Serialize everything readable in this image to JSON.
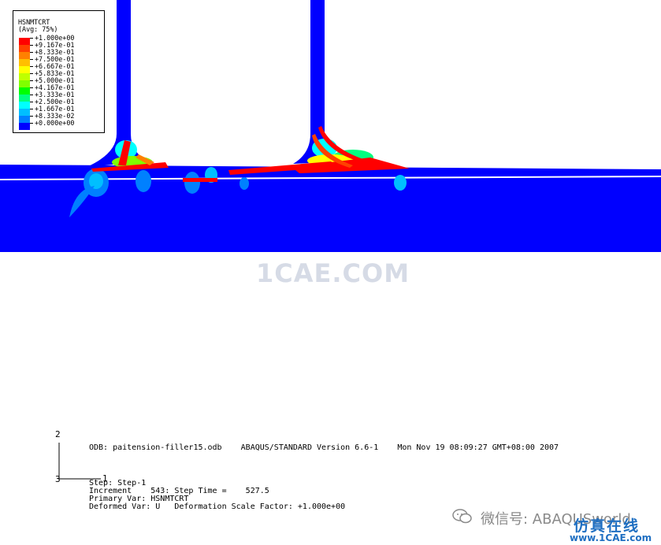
{
  "legend": {
    "title": "HSNMTCRT",
    "subtitle": "(Avg: 75%)",
    "entries": [
      {
        "label": "+1.000e+00",
        "color": "#ff0000"
      },
      {
        "label": "+9.167e-01",
        "color": "#ff4000"
      },
      {
        "label": "+8.333e-01",
        "color": "#ff8000"
      },
      {
        "label": "+7.500e-01",
        "color": "#ffbf00"
      },
      {
        "label": "+6.667e-01",
        "color": "#ffff00"
      },
      {
        "label": "+5.833e-01",
        "color": "#bfff00"
      },
      {
        "label": "+5.000e-01",
        "color": "#80ff00"
      },
      {
        "label": "+4.167e-01",
        "color": "#00ff00"
      },
      {
        "label": "+3.333e-01",
        "color": "#00ff80"
      },
      {
        "label": "+2.500e-01",
        "color": "#00ffff"
      },
      {
        "label": "+1.667e-01",
        "color": "#00bfff"
      },
      {
        "label": "+8.333e-02",
        "color": "#0080ff"
      },
      {
        "label": "+0.000e+00",
        "color": "#0000ff"
      }
    ]
  },
  "triad": {
    "axis_2": "2",
    "axis_3": "3",
    "axis_1": "1"
  },
  "info": {
    "odb_line": "ODB: paitension-filler15.odb    ABAQUS/STANDARD Version 6.6-1    Mon Nov 19 08:09:27 GMT+08:00 2007",
    "step_line": "Step: Step-1",
    "increment_line": "Increment    543: Step Time =    527.5",
    "primary_var_line": "Primary Var: HSNMTCRT",
    "deformed_var_line": "Deformed Var: U   Deformation Scale Factor: +1.000e+00"
  },
  "watermark": "1CAE.COM",
  "footer": {
    "wechat_label": "微信号: ABAQUSworld",
    "brand_cn": "仿真在线",
    "brand_site": "www.1CAE.com"
  },
  "colors": {
    "model_blue": "#0000ff",
    "failure_red": "#ff0000",
    "background": "#ffffff"
  }
}
